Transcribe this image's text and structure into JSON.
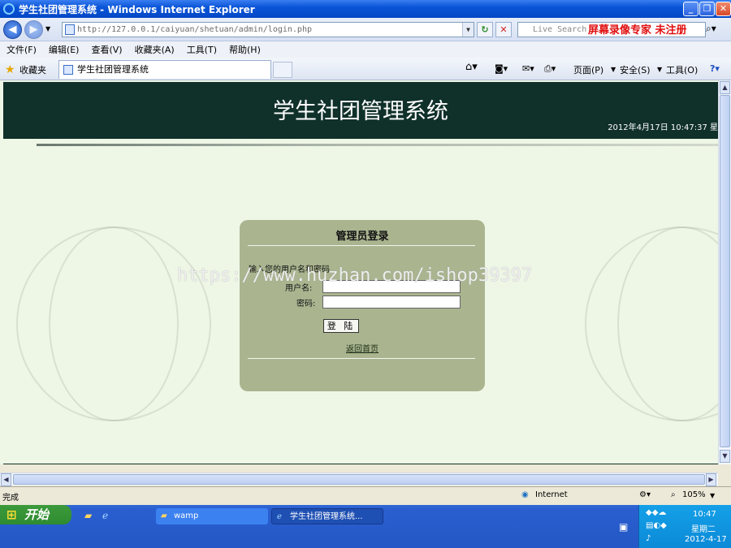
{
  "window": {
    "title": "学生社团管理系统 - Windows Internet Explorer"
  },
  "navigation": {
    "address": "http://127.0.0.1/caiyuan/shetuan/admin/login.php",
    "search_placeholder": "Live Search",
    "recorder_watermark": "屏幕录像专家 未注册"
  },
  "menu": [
    "文件(F)",
    "编辑(E)",
    "查看(V)",
    "收藏夹(A)",
    "工具(T)",
    "帮助(H)"
  ],
  "favorites": {
    "label": "收藏夹",
    "tab_title": "学生社团管理系统"
  },
  "command_bar": {
    "page": "页面(P)",
    "safety": "安全(S)",
    "tools": "工具(O)"
  },
  "site": {
    "title": "学生社团管理系统",
    "datetime": "2012年4月17日 10:47:37 星"
  },
  "login": {
    "heading": "管理员登录",
    "tip": "输入您的用户名和密码",
    "username_label": "用户名:",
    "password_label": "密码:",
    "username_value": "",
    "password_value": "",
    "submit_label": "登 陆",
    "back_link": "返回首页"
  },
  "overlay_watermark": "https://www.huzhan.com/ishop39397",
  "status": {
    "text": "完成",
    "zone": "Internet",
    "zoom": "105%"
  },
  "taskbar": {
    "start_label": "开始",
    "tasks": [
      "wamp",
      "学生社团管理系统..."
    ],
    "clock": "10:47",
    "weekday": "星期二",
    "date": "2012-4-17"
  },
  "colors": {
    "header_bg": "#10302a",
    "panel_bg": "#aab590",
    "content_bg": "#eef6e6"
  }
}
